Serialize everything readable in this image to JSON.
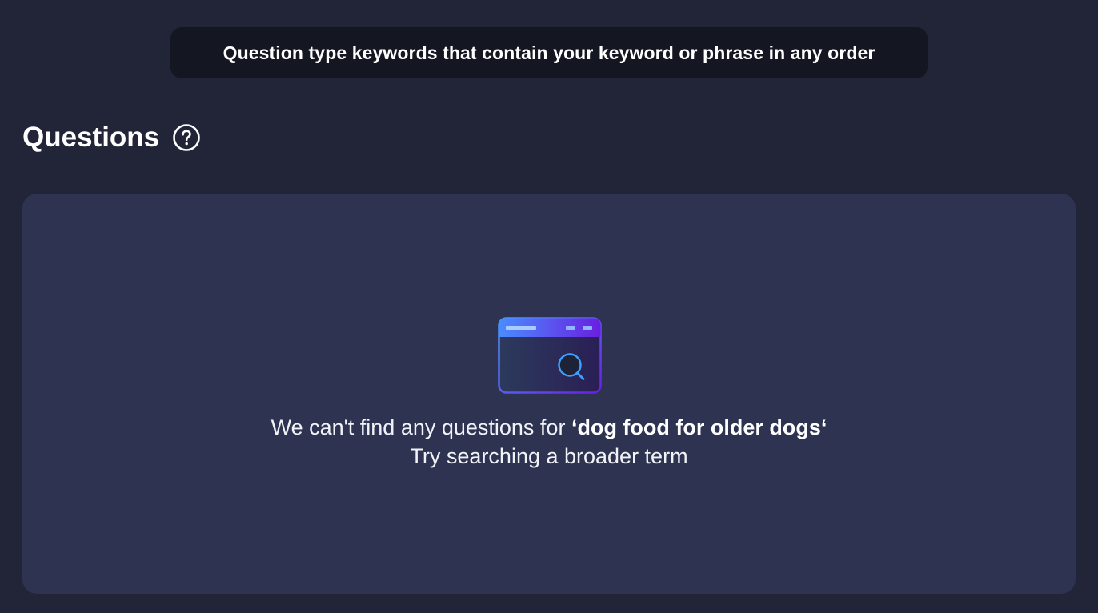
{
  "tooltip": {
    "text": "Question type keywords that contain your keyword or phrase in any order"
  },
  "section": {
    "title": "Questions",
    "help_icon": "question-circle-icon"
  },
  "empty_state": {
    "illustration_icon": "browser-search-icon",
    "message_prefix": "We can't find any questions for ",
    "query": "‘dog food for older dogs‘",
    "hint": "Try searching a broader term"
  },
  "colors": {
    "background": "#212537",
    "tooltip_bg": "#141722",
    "card_bg": "#2d3350",
    "gradient_start": "#4a9cff",
    "gradient_end": "#6a1fe0"
  }
}
